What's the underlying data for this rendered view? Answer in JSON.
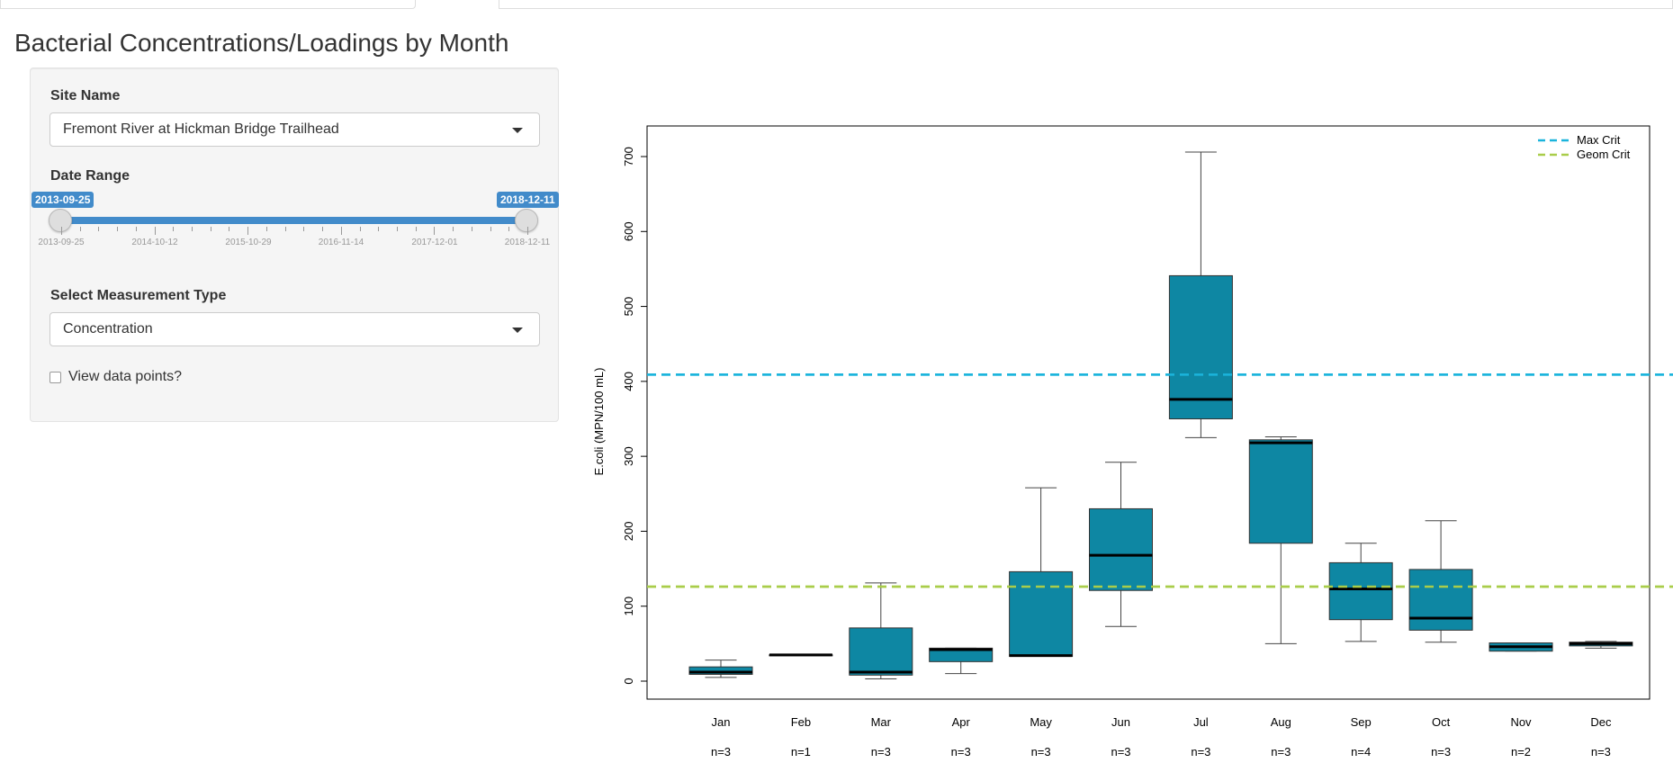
{
  "page": {
    "title": "Bacterial Concentrations/Loadings by Month"
  },
  "sidebar": {
    "site": {
      "label": "Site Name",
      "value": "Fremont River at Hickman Bridge Trailhead"
    },
    "date_range": {
      "label": "Date Range",
      "start": "2013-09-25",
      "end": "2018-12-11",
      "tick_labels": [
        "2013-09-25",
        "2014-10-12",
        "2015-10-29",
        "2016-11-14",
        "2017-12-01",
        "2018-12-11"
      ]
    },
    "measurement": {
      "label": "Select Measurement Type",
      "value": "Concentration"
    },
    "view_points": {
      "label": "View data points?",
      "checked": false
    }
  },
  "colors": {
    "box": "#0e87a3",
    "max_crit": "#1bb4dc",
    "geom_crit": "#a9cd4a",
    "slider": "#428bca"
  },
  "chart_data": {
    "type": "boxplot",
    "xlabel": "",
    "ylabel": "E.coli (MPN/100 mL)",
    "ylim": [
      0,
      730
    ],
    "yticks": [
      0,
      100,
      200,
      300,
      400,
      500,
      600,
      700
    ],
    "categories": [
      "Jan",
      "Feb",
      "Mar",
      "Apr",
      "May",
      "Jun",
      "Jul",
      "Aug",
      "Sep",
      "Oct",
      "Nov",
      "Dec"
    ],
    "counts": [
      "n=3",
      "n=1",
      "n=3",
      "n=3",
      "n=3",
      "n=3",
      "n=3",
      "n=3",
      "n=4",
      "n=3",
      "n=2",
      "n=3"
    ],
    "boxes": [
      {
        "min": 5,
        "q1": 9,
        "median": 12,
        "q3": 19,
        "max": 28
      },
      {
        "min": 35,
        "q1": 35,
        "median": 35,
        "q3": 35,
        "max": 35
      },
      {
        "min": 3,
        "q1": 8,
        "median": 12,
        "q3": 71,
        "max": 131
      },
      {
        "min": 10,
        "q1": 26,
        "median": 42,
        "q3": 44,
        "max": 44
      },
      {
        "min": 33,
        "q1": 33,
        "median": 34,
        "q3": 146,
        "max": 258
      },
      {
        "min": 73,
        "q1": 121,
        "median": 168,
        "q3": 230,
        "max": 292
      },
      {
        "min": 325,
        "q1": 350,
        "median": 376,
        "q3": 541,
        "max": 706
      },
      {
        "min": 50,
        "q1": 184,
        "median": 318,
        "q3": 322,
        "max": 326
      },
      {
        "min": 53,
        "q1": 82,
        "median": 123,
        "q3": 158,
        "max": 184
      },
      {
        "min": 52,
        "q1": 68,
        "median": 84,
        "q3": 149,
        "max": 214
      },
      {
        "min": 40,
        "q1": 40,
        "median": 46,
        "q3": 51,
        "max": 51
      },
      {
        "min": 44,
        "q1": 47,
        "median": 50,
        "q3": 52,
        "max": 53
      }
    ],
    "reference_lines": [
      {
        "name": "Max Crit",
        "value": 409,
        "color": "#1bb4dc"
      },
      {
        "name": "Geom Crit",
        "value": 126,
        "color": "#a9cd4a"
      }
    ],
    "legend": {
      "position": "top-right",
      "entries": [
        "Max Crit",
        "Geom Crit"
      ]
    }
  }
}
